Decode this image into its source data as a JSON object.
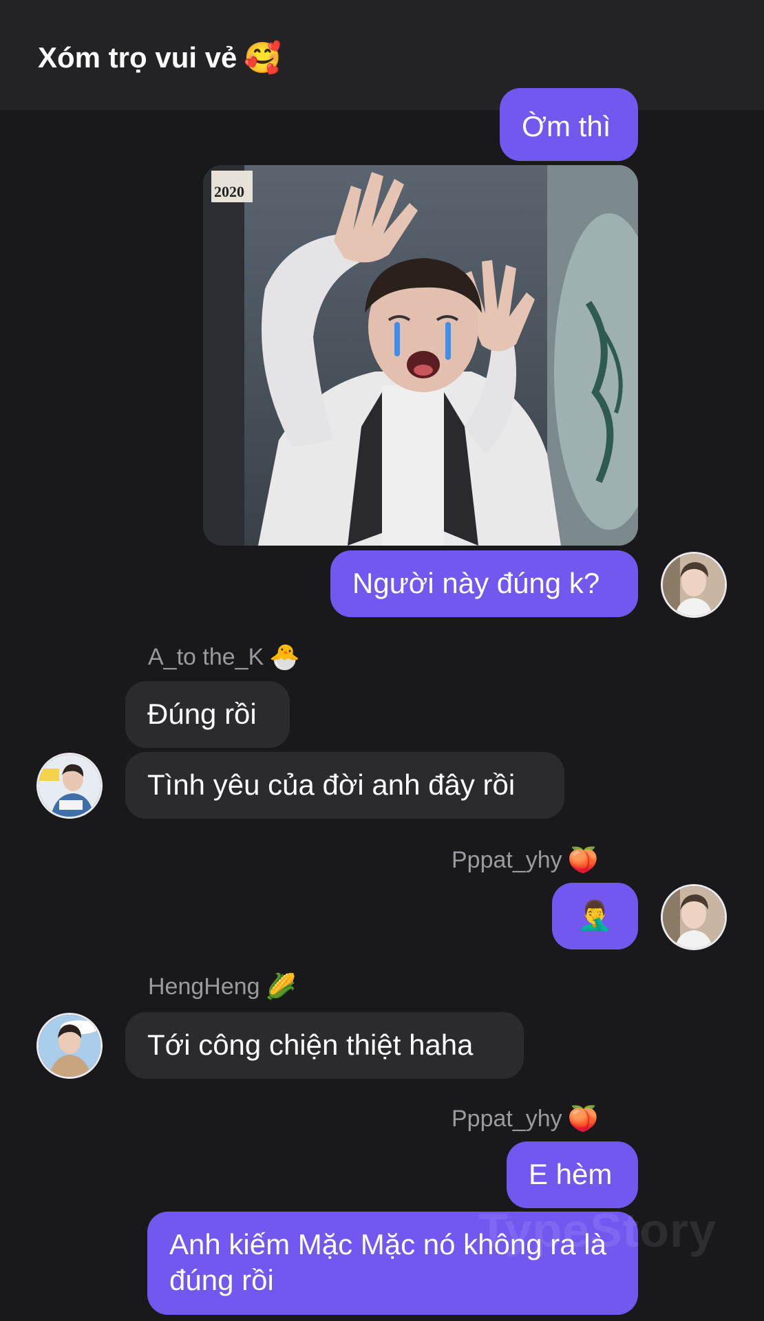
{
  "header": {
    "title": "Xóm trọ vui vẻ",
    "title_emoji": "🥰"
  },
  "messages": [
    {
      "sender": "",
      "text": "Ờm thì",
      "direction": "out"
    },
    {
      "sender": "",
      "text": "Người này đúng k?",
      "direction": "out"
    },
    {
      "sender": "A_to the_K",
      "sender_emoji": "🐣",
      "text": "Đúng rồi",
      "direction": "in"
    },
    {
      "sender": "",
      "text": "Tình yêu của đời anh đây rồi",
      "direction": "in"
    },
    {
      "sender": "Pppat_yhy",
      "sender_emoji": "🍑",
      "text": "🤦‍♂️",
      "direction": "out"
    },
    {
      "sender": "HengHeng",
      "sender_emoji": "🌽",
      "text": "Tới công chiện thiệt haha",
      "direction": "in"
    },
    {
      "sender": "Pppat_yhy",
      "sender_emoji": "🍑",
      "text": "E hèm",
      "direction": "out"
    },
    {
      "sender": "",
      "text": "Anh kiếm Mặc Mặc nó không ra là đúng rồi",
      "direction": "out"
    }
  ],
  "photo": {
    "stamp_text": "2020"
  },
  "watermark": "TypeStory",
  "colors": {
    "background": "#19191b",
    "header": "#232325",
    "outgoing_bubble": "#7358f0",
    "incoming_bubble": "#2b2b2e",
    "sender_name": "#9a9aa0"
  }
}
